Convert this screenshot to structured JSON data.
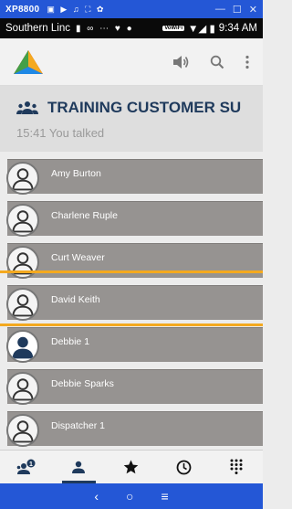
{
  "window": {
    "title": "XP8800",
    "title_icons": "▣ ▶ ♫ ⛶ ✿",
    "controls": [
      "—",
      "☐",
      "✕"
    ]
  },
  "status_bar": {
    "carrier": "Southern Linc",
    "icons": "▮ ∞ ⋯ ♥ ●",
    "wifi_badge": "VoWiFi",
    "signal": "▼◢ ▮",
    "time": "9:34 AM"
  },
  "app_bar": {
    "icons": [
      "logo-icon",
      "speaker-icon",
      "search-icon",
      "overflow-menu-icon"
    ]
  },
  "group": {
    "name": "TRAINING CUSTOMER SU",
    "subtitle": "15:41 You talked",
    "icon": "group-icon"
  },
  "contacts": [
    {
      "name": "Amy Burton",
      "avatar": "outline"
    },
    {
      "name": "Charlene Ruple",
      "avatar": "outline"
    },
    {
      "name": "Curt Weaver",
      "avatar": "outline"
    },
    {
      "name": "David Keith",
      "avatar": "outline"
    },
    {
      "name": "Debbie 1",
      "avatar": "filled"
    },
    {
      "name": "Debbie Sparks",
      "avatar": "outline"
    },
    {
      "name": "Dispatcher 1",
      "avatar": "outline"
    }
  ],
  "colors": {
    "accent": "#f4a91f",
    "title_blue": "#1f3a5c",
    "list_gray": "#969391",
    "window_blue": "#2457d6"
  },
  "bottom_nav": {
    "tabs": [
      "groups-alert-icon",
      "contacts-icon",
      "favorites-icon",
      "history-icon",
      "dialpad-icon"
    ],
    "active": "contacts-icon"
  },
  "system_nav": {
    "back": "‹",
    "home": "○",
    "recents": "≡"
  }
}
